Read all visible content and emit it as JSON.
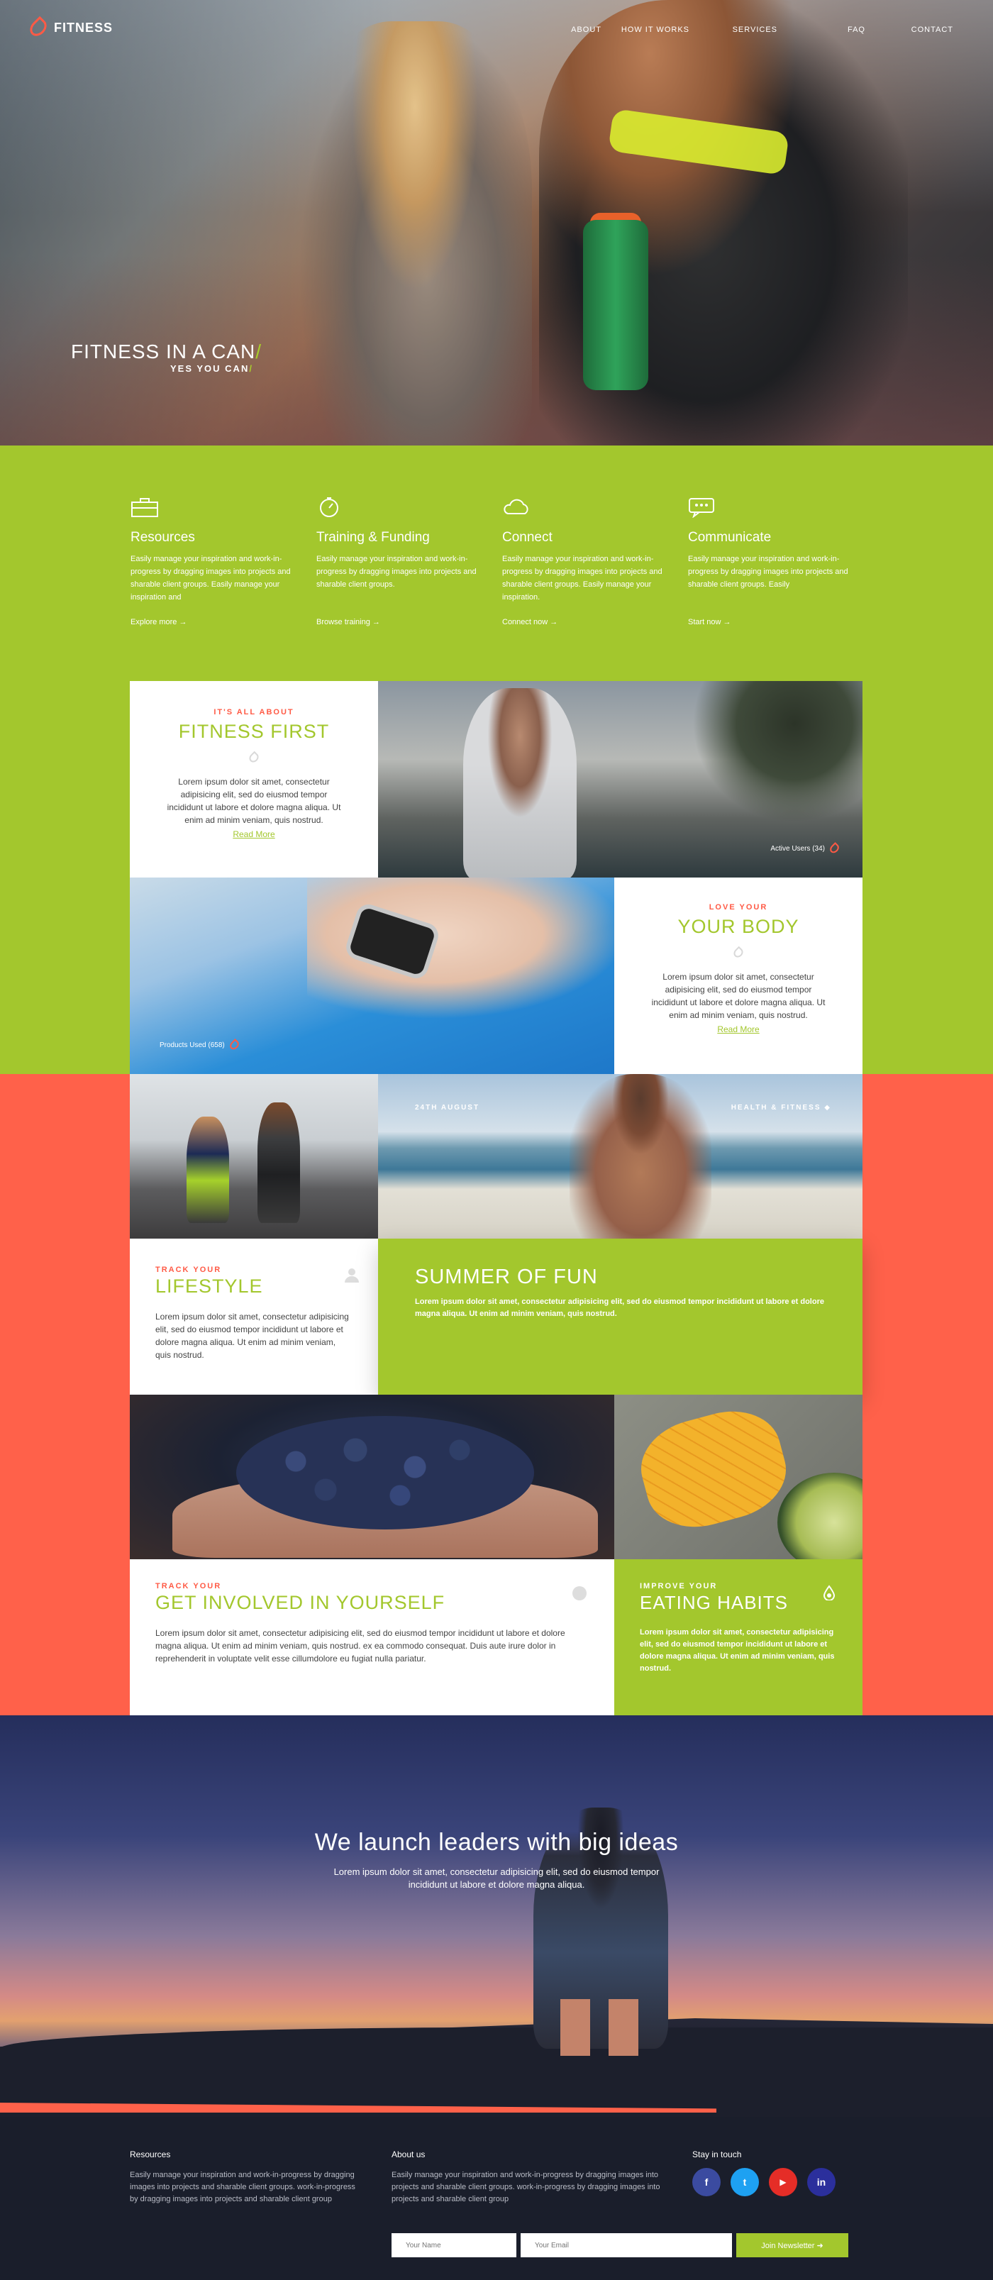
{
  "brand": {
    "name": "FITNESS",
    "accent": "#a3c72d",
    "coral": "#ff614a",
    "dark": "#1a1e2b"
  },
  "nav": {
    "items": [
      "ABOUT",
      "HOW IT WORKS",
      "SERVICES",
      "FAQ",
      "CONTACT"
    ]
  },
  "hero": {
    "title": "FITNESS IN A CAN",
    "slash": "/",
    "subtitle": "YES YOU CAN"
  },
  "features": [
    {
      "icon": "briefcase-icon",
      "title": "Resources",
      "text": "Easily manage your inspiration and work-in-progress by dragging images into projects and sharable client groups. Easily manage your inspiration and",
      "link": "Explore more →"
    },
    {
      "icon": "stopwatch-icon",
      "title": "Training & Funding",
      "text": "Easily manage your inspiration and work-in-progress by dragging images into projects and sharable client groups.",
      "link": "Browse training →"
    },
    {
      "icon": "cloud-icon",
      "title": "Connect",
      "text": "Easily manage your inspiration and work-in-progress by dragging images into projects and sharable client groups. Easily manage your inspiration.",
      "link": "Connect now →"
    },
    {
      "icon": "chat-icon",
      "title": "Communicate",
      "text": "Easily manage your inspiration and work-in-progress by dragging images into projects and sharable client groups. Easily",
      "link": "Start now →"
    }
  ],
  "cards": {
    "fitness_first": {
      "kicker": "IT'S ALL ABOUT",
      "title": "FITNESS FIRST",
      "text": "Lorem ipsum dolor sit amet, consectetur adipisicing elit, sed do eiusmod tempor incididunt ut labore et dolore magna aliqua. Ut enim ad minim veniam, quis nostrud.",
      "more": "Read More"
    },
    "your_body": {
      "kicker": "LOVE YOUR",
      "title": "YOUR BODY",
      "text": "Lorem ipsum dolor sit amet, consectetur adipisicing elit, sed do eiusmod tempor incididunt ut labore et dolore magna aliqua. Ut enim ad minim veniam, quis nostrud.",
      "more": "Read More"
    },
    "active_users": "Active Users (34)",
    "products_used": "Products Used (658)",
    "beach_date": "24TH AUGUST",
    "beach_tag": "HEALTH & FITNESS",
    "lifestyle": {
      "kicker": "TRACK YOUR",
      "title": "LIFESTYLE",
      "text": "Lorem ipsum dolor sit amet, consectetur adipisicing elit, sed do eiusmod tempor incididunt ut labore et dolore magna aliqua. Ut enim ad minim veniam, quis nostrud."
    },
    "summer": {
      "title": "SUMMER OF FUN",
      "text": "Lorem ipsum dolor sit amet, consectetur adipisicing elit, sed do eiusmod tempor incididunt ut labore et dolore magna aliqua. Ut enim ad minim veniam, quis nostrud."
    },
    "involved": {
      "kicker": "TRACK YOUR",
      "title": "GET INVOLVED IN YOURSELF",
      "text": "Lorem ipsum dolor sit amet, consectetur adipisicing elit, sed do eiusmod tempor incididunt ut labore et dolore magna aliqua. Ut enim ad minim veniam, quis nostrud. ex ea commodo consequat. Duis aute irure dolor in reprehenderit in voluptate velit esse cillumdolore eu fugiat nulla pariatur."
    },
    "eating": {
      "kicker": "IMPROVE YOUR",
      "title": "EATING HABITS",
      "text": "Lorem ipsum dolor sit amet, consectetur adipisicing elit, sed do eiusmod tempor incididunt ut labore et dolore magna aliqua. Ut enim ad minim veniam, quis nostrud."
    }
  },
  "leaders": {
    "title": "We launch leaders with big ideas",
    "text": "Lorem ipsum dolor sit amet, consectetur adipisicing elit, sed do eiusmod tempor incididunt ut labore et dolore magna aliqua."
  },
  "footer": {
    "resources_title": "Resources",
    "resources_text": "Easily manage your inspiration and work-in-progress by dragging images into projects and sharable client groups. work-in-progress by dragging images into projects and sharable client group",
    "about_title": "About us",
    "about_text": "Easily manage your inspiration and work-in-progress by dragging images into projects and sharable client groups. work-in-progress by dragging images into projects and sharable client group",
    "stay_title": "Stay in touch",
    "socials": [
      {
        "icon": "facebook-icon",
        "glyph": "f",
        "color": "#3b4ba0"
      },
      {
        "icon": "twitter-icon",
        "glyph": "t",
        "color": "#1ea1f2"
      },
      {
        "icon": "youtube-icon",
        "glyph": "▶",
        "color": "#e52d27"
      },
      {
        "icon": "linkedin-icon",
        "glyph": "in",
        "color": "#2b2f9c"
      }
    ],
    "name_placeholder": "Your Name",
    "email_placeholder": "Your Email",
    "newsletter_button": "Join Newsletter ➜"
  }
}
